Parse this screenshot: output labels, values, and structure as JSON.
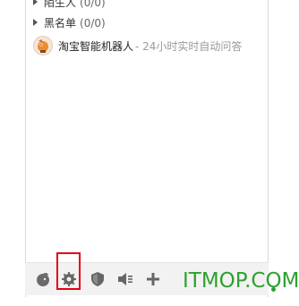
{
  "groups": [
    {
      "label": "陌生人",
      "count": "(0/0)"
    },
    {
      "label": "黑名单",
      "count": "(0/0)"
    }
  ],
  "contact": {
    "name": "淘宝智能机器人",
    "signature": "- 24小时实时自动问答"
  },
  "toolbar": {
    "icons": [
      "taobao-icon",
      "gear-icon",
      "shield-icon",
      "speaker-icon",
      "plus-icon"
    ]
  },
  "watermark": "ITMOP.COM",
  "colors": {
    "highlight": "#e60012",
    "watermark": "#2ea12e",
    "icon": "#666666"
  }
}
